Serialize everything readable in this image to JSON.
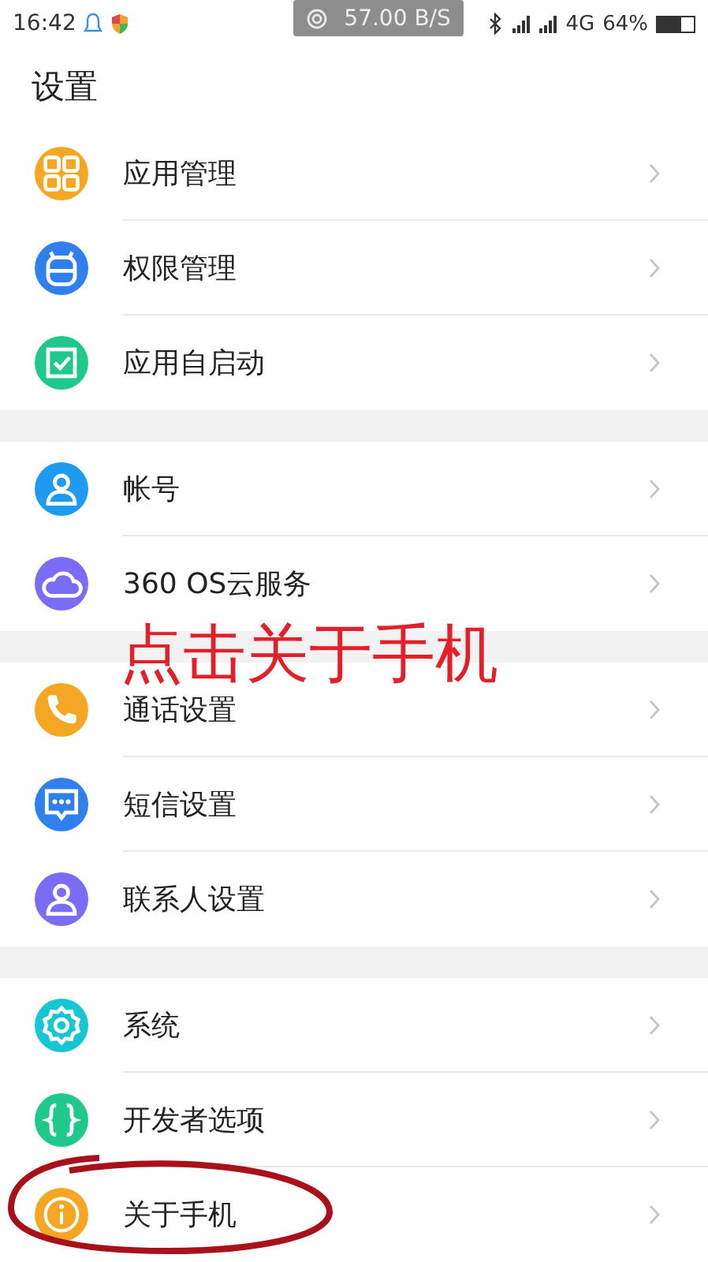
{
  "status_bar": {
    "time": "16:42",
    "net_speed": "57.00 B/S",
    "network": "4G",
    "battery": "64%"
  },
  "header": {
    "title": "设置"
  },
  "groups": [
    {
      "items": [
        {
          "label": "应用管理",
          "kind": "apps",
          "color": "#f5a623"
        },
        {
          "label": "权限管理",
          "kind": "robot",
          "color": "#2f80ed"
        },
        {
          "label": "应用自启动",
          "kind": "check",
          "color": "#1fc98b"
        }
      ]
    },
    {
      "items": [
        {
          "label": "帐号",
          "kind": "person",
          "color": "#1e9bf0"
        },
        {
          "label": "360 OS云服务",
          "kind": "cloud",
          "color": "#7b6cf6"
        }
      ]
    },
    {
      "items": [
        {
          "label": "通话设置",
          "kind": "phone",
          "color": "#f5a623"
        },
        {
          "label": "短信设置",
          "kind": "message",
          "color": "#2f80ed"
        },
        {
          "label": "联系人设置",
          "kind": "person",
          "color": "#7b6cf6"
        }
      ]
    },
    {
      "items": [
        {
          "label": "系统",
          "kind": "gear",
          "color": "#16c6d2"
        },
        {
          "label": "开发者选项",
          "kind": "braces",
          "color": "#1fc98b"
        },
        {
          "label": "关于手机",
          "kind": "info",
          "color": "#f5a623"
        }
      ]
    }
  ],
  "annotation": {
    "text": "点击关于手机"
  }
}
